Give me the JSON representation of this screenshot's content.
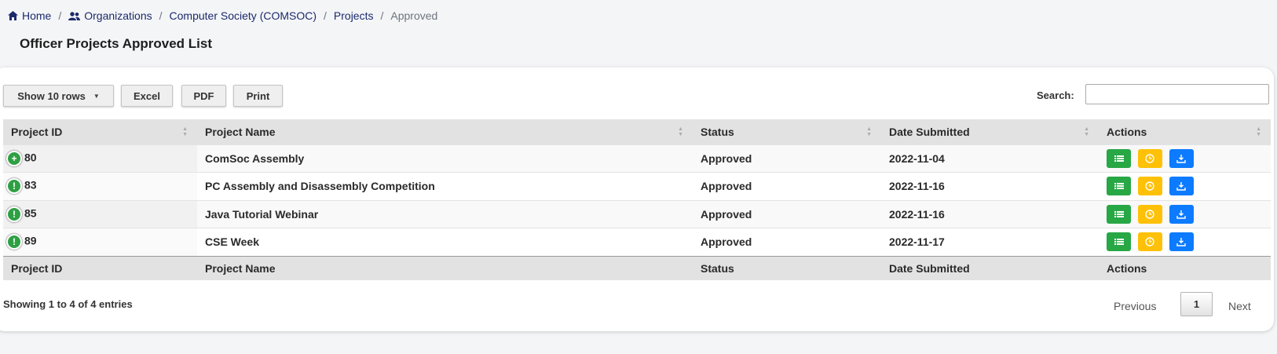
{
  "breadcrumb": {
    "home": "Home",
    "organizations": "Organizations",
    "organization": "Computer Society (COMSOC)",
    "projects": "Projects",
    "current": "Approved"
  },
  "page_title": "Officer Projects Approved List",
  "toolbar": {
    "show_rows": "Show 10 rows",
    "excel": "Excel",
    "pdf": "PDF",
    "print": "Print",
    "search_label": "Search:",
    "search_value": ""
  },
  "table": {
    "columns": [
      "Project ID",
      "Project Name",
      "Status",
      "Date Submitted",
      "Actions"
    ],
    "rows": [
      {
        "id": "80",
        "name": "ComSoc Assembly",
        "status": "Approved",
        "date": "2022-11-04",
        "expander": "+"
      },
      {
        "id": "83",
        "name": "PC Assembly and Disassembly Competition",
        "status": "Approved",
        "date": "2022-11-16",
        "expander": "!"
      },
      {
        "id": "85",
        "name": "Java Tutorial Webinar",
        "status": "Approved",
        "date": "2022-11-16",
        "expander": "!"
      },
      {
        "id": "89",
        "name": "CSE Week",
        "status": "Approved",
        "date": "2022-11-17",
        "expander": "!"
      }
    ],
    "actions": [
      "list-icon",
      "clock-icon",
      "download-icon"
    ]
  },
  "footer": {
    "info": "Showing 1 to 4 of 4 entries",
    "previous": "Previous",
    "current_page": "1",
    "next": "Next"
  },
  "colors": {
    "nav": "#1b2a6b",
    "approved": "#15803d",
    "btn_green": "#28a745",
    "btn_yellow": "#ffc107",
    "btn_blue": "#0d7bff"
  }
}
